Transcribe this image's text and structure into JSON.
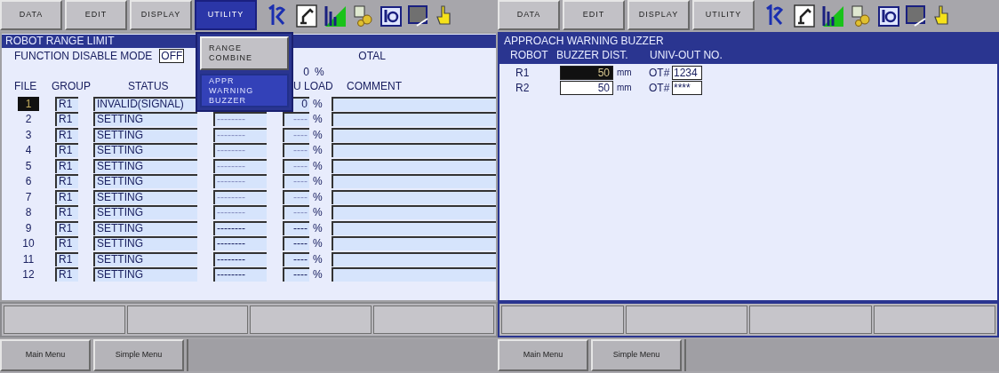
{
  "left_screen": {
    "menu_tabs": [
      {
        "label": "DATA",
        "selected": false
      },
      {
        "label": "EDIT",
        "selected": false
      },
      {
        "label": "DISPLAY",
        "selected": false
      },
      {
        "label": "UTILITY",
        "selected": true
      }
    ],
    "utility_menu": [
      {
        "label": "RANGE COMBINE",
        "selected": false
      },
      {
        "label": "APPR WARNING BUZZER",
        "selected": true
      }
    ],
    "title": "ROBOT RANGE LIMIT",
    "mode_label": "FUNCTION DISABLE MODE",
    "mode_value": "OFF",
    "total_label": "OTAL",
    "total_value": "0",
    "total_unit": "%",
    "columns": [
      "FILE",
      "GROUP",
      "STATUS",
      "U LOAD",
      "COMMENT"
    ],
    "rows": [
      {
        "file": "1",
        "group": "R1",
        "status": "INVALID(SIGNAL)",
        "load": "0",
        "unit": "%",
        "selected": true
      },
      {
        "file": "2",
        "group": "R1",
        "status": "SETTING",
        "column_4": "--------",
        "load": "----",
        "unit": "%",
        "selected": false,
        "dimmed": true
      },
      {
        "file": "3",
        "group": "R1",
        "status": "SETTING",
        "column_4": "--------",
        "load": "----",
        "unit": "%",
        "selected": false,
        "dimmed": true
      },
      {
        "file": "4",
        "group": "R1",
        "status": "SETTING",
        "column_4": "--------",
        "load": "----",
        "unit": "%",
        "selected": false,
        "dimmed": true
      },
      {
        "file": "5",
        "group": "R1",
        "status": "SETTING",
        "column_4": "--------",
        "load": "----",
        "unit": "%",
        "selected": false,
        "dimmed": true
      },
      {
        "file": "6",
        "group": "R1",
        "status": "SETTING",
        "column_4": "--------",
        "load": "----",
        "unit": "%",
        "selected": false,
        "dimmed": true
      },
      {
        "file": "7",
        "group": "R1",
        "status": "SETTING",
        "column_4": "--------",
        "load": "----",
        "unit": "%",
        "selected": false,
        "dimmed": true
      },
      {
        "file": "8",
        "group": "R1",
        "status": "SETTING",
        "column_4": "--------",
        "load": "----",
        "unit": "%",
        "selected": false,
        "dimmed": true
      },
      {
        "file": "9",
        "group": "R1",
        "status": "SETTING",
        "column_4": "--------",
        "load": "----",
        "unit": "%",
        "selected": false,
        "dimmed": false
      },
      {
        "file": "10",
        "group": "R1",
        "status": "SETTING",
        "column_4": "--------",
        "load": "----",
        "unit": "%",
        "selected": false,
        "dimmed": false
      },
      {
        "file": "11",
        "group": "R1",
        "status": "SETTING",
        "column_4": "--------",
        "load": "----",
        "unit": "%",
        "selected": false,
        "dimmed": false
      },
      {
        "file": "12",
        "group": "R1",
        "status": "SETTING",
        "column_4": "--------",
        "load": "----",
        "unit": "%",
        "selected": false,
        "dimmed": false
      }
    ],
    "bottom_menu": [
      "Main Menu",
      "Simple Menu"
    ]
  },
  "right_screen": {
    "menu_tabs": [
      {
        "label": "DATA",
        "selected": false
      },
      {
        "label": "EDIT",
        "selected": false
      },
      {
        "label": "DISPLAY",
        "selected": false
      },
      {
        "label": "UTILITY",
        "selected": false
      }
    ],
    "title": "APPROACH WARNING BUZZER",
    "columns": [
      "ROBOT",
      "BUZZER DIST.",
      "UNIV-OUT NO."
    ],
    "rows": [
      {
        "robot": "R1",
        "distance": "50",
        "unit": "mm",
        "out_label": "OT#",
        "out_no": "1234",
        "selected": true
      },
      {
        "robot": "R2",
        "distance": "50",
        "unit": "mm",
        "out_label": "OT#",
        "out_no": "****",
        "selected": false
      }
    ],
    "bottom_menu": [
      "Main Menu",
      "Simple Menu"
    ]
  }
}
